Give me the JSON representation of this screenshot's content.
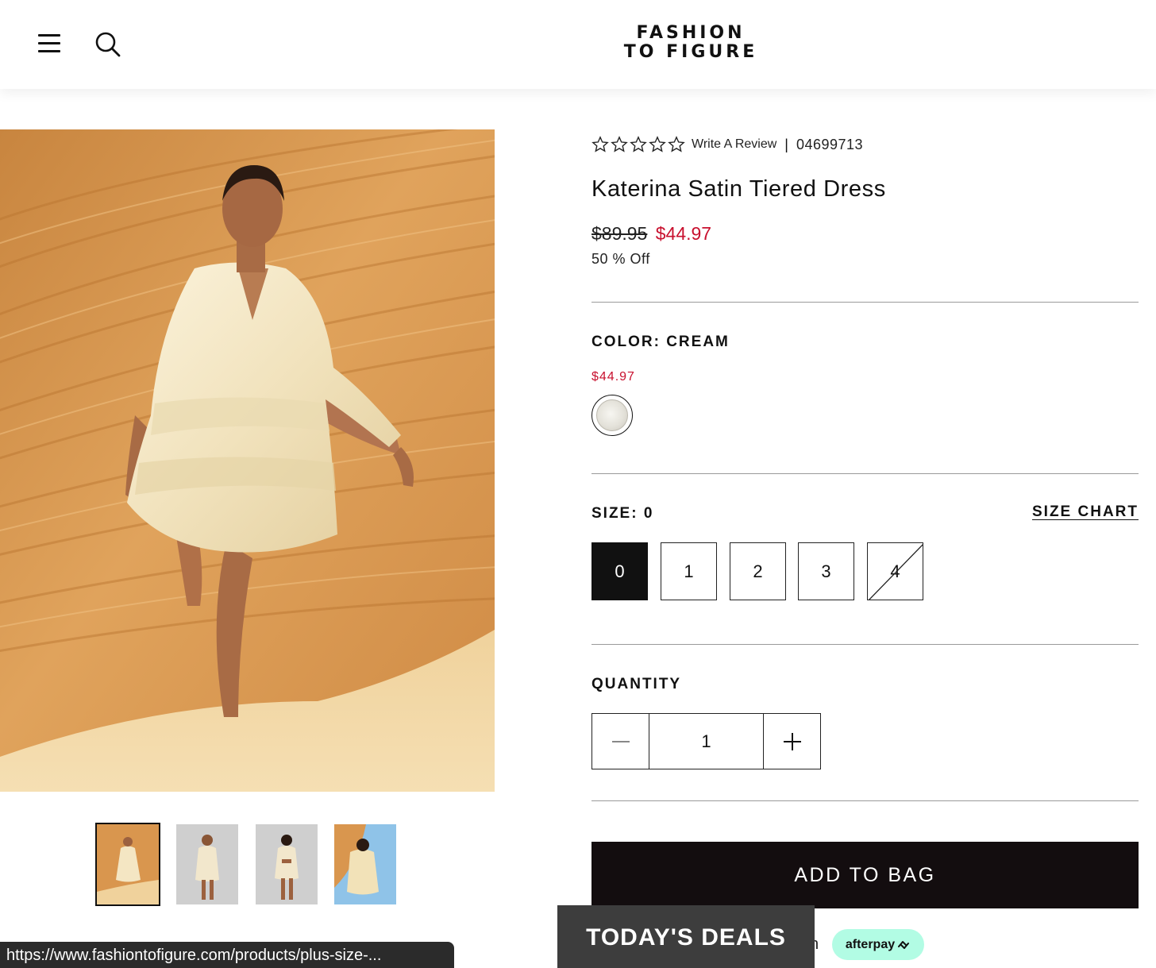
{
  "header": {
    "menu_icon": "hamburger-menu-icon",
    "search_icon": "search-icon",
    "logo_line1": "FASHION",
    "logo_line2": "TO FIGURE"
  },
  "gallery": {
    "main_image_alt": "model-in-cream-satin-dress-desert",
    "thumbnail_count": 4,
    "active_thumbnail_index": 0
  },
  "product": {
    "rating": 0,
    "rating_max": 5,
    "review_link": "Write A Review",
    "separator": "|",
    "sku": "04699713",
    "title": "Katerina Satin Tiered Dress",
    "price_original": "$89.95",
    "price_sale": "$44.97",
    "discount": "50 % Off",
    "sale_color": "#c8102e"
  },
  "color": {
    "label": "COLOR: CREAM",
    "price": "$44.97",
    "swatch": "cream"
  },
  "size": {
    "label": "SIZE: 0",
    "chart_link": "SIZE CHART",
    "options": [
      {
        "label": "0",
        "state": "selected"
      },
      {
        "label": "1",
        "state": "available"
      },
      {
        "label": "2",
        "state": "available"
      },
      {
        "label": "3",
        "state": "available"
      },
      {
        "label": "4",
        "state": "unavailable"
      }
    ]
  },
  "quantity": {
    "label": "QUANTITY",
    "value": "1",
    "minus_icon": "minus-icon",
    "plus_icon": "plus-icon"
  },
  "actions": {
    "add_to_bag": "ADD TO BAG",
    "todays_deals": "TODAY'S DEALS",
    "afterpay_label": "afterpay",
    "afterpay_partial": "n",
    "afterpay_color": "#b2fce4"
  },
  "status_bar": {
    "url": "https://www.fashiontofigure.com/products/plus-size-..."
  }
}
